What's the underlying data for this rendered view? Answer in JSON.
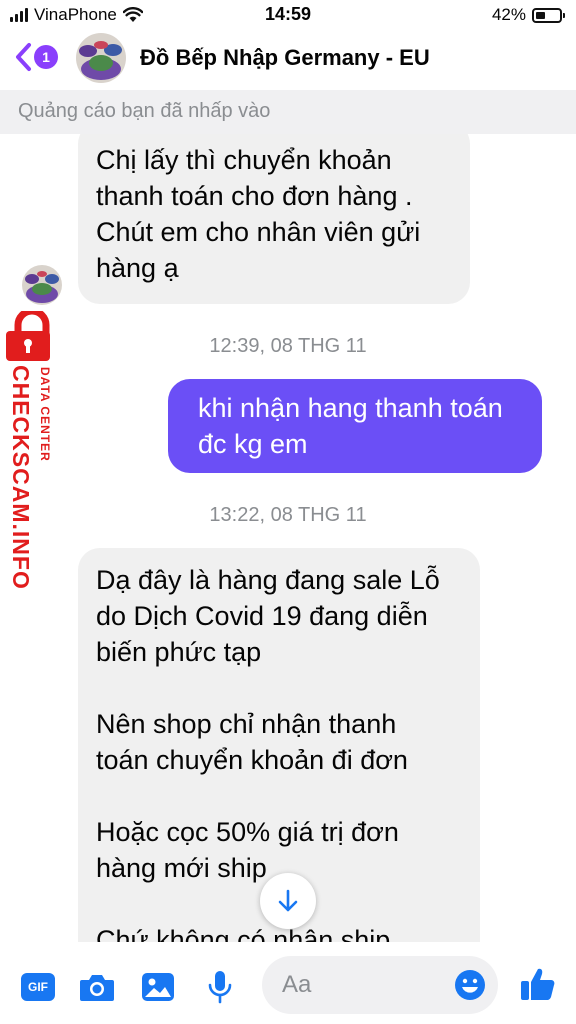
{
  "status_bar": {
    "carrier": "VinaPhone",
    "time": "14:59",
    "battery_percent": "42%",
    "battery_level": 0.42,
    "icons": [
      "signal-icon",
      "wifi-icon",
      "battery-icon"
    ]
  },
  "header": {
    "back_badge": "1",
    "title": "Đồ Bếp Nhập Germany - EU",
    "icons": [
      "back-chevron-icon"
    ]
  },
  "ad_notice": "Quảng cáo bạn đã nhấp vào",
  "messages": [
    {
      "direction": "incoming",
      "lines": [
        "Chị lấy thì chuyển khoản",
        "thanh toán cho đơn hàng .",
        "Chút em cho nhân viên gửi",
        "hàng ạ"
      ]
    },
    {
      "timestamp": "12:39, 08 THG 11"
    },
    {
      "direction": "outgoing",
      "lines": [
        "khi nhận hang thanh toán",
        "đc kg em"
      ]
    },
    {
      "timestamp": "13:22, 08 THG 11"
    },
    {
      "direction": "incoming",
      "lines": [
        "Dạ đây là hàng đang sale Lỗ",
        "do Dịch Covid 19 đang diễn",
        "biến phức tạp",
        "",
        "Nên shop chỉ nhận thanh",
        "toán chuyển khoản đi đơn",
        "",
        "Hoặc cọc 50% giá trị đơn",
        "hàng mới ship",
        "",
        "Chứ không có nhận ship"
      ]
    }
  ],
  "watermark": {
    "main": "CHECKSCAM.INFO",
    "sub": "DATA CENTER",
    "color": "#e11d1d"
  },
  "composer": {
    "placeholder": "Aa",
    "gif_label": "GIF",
    "icons": [
      "gif-icon",
      "camera-icon",
      "image-icon",
      "microphone-icon",
      "emoji-icon",
      "thumbs-up-icon"
    ]
  },
  "colors": {
    "accent": "#6b4ff6",
    "icon_blue": "#1877f2",
    "badge": "#8a3ffc",
    "incoming_bubble": "#f0f0f0"
  }
}
